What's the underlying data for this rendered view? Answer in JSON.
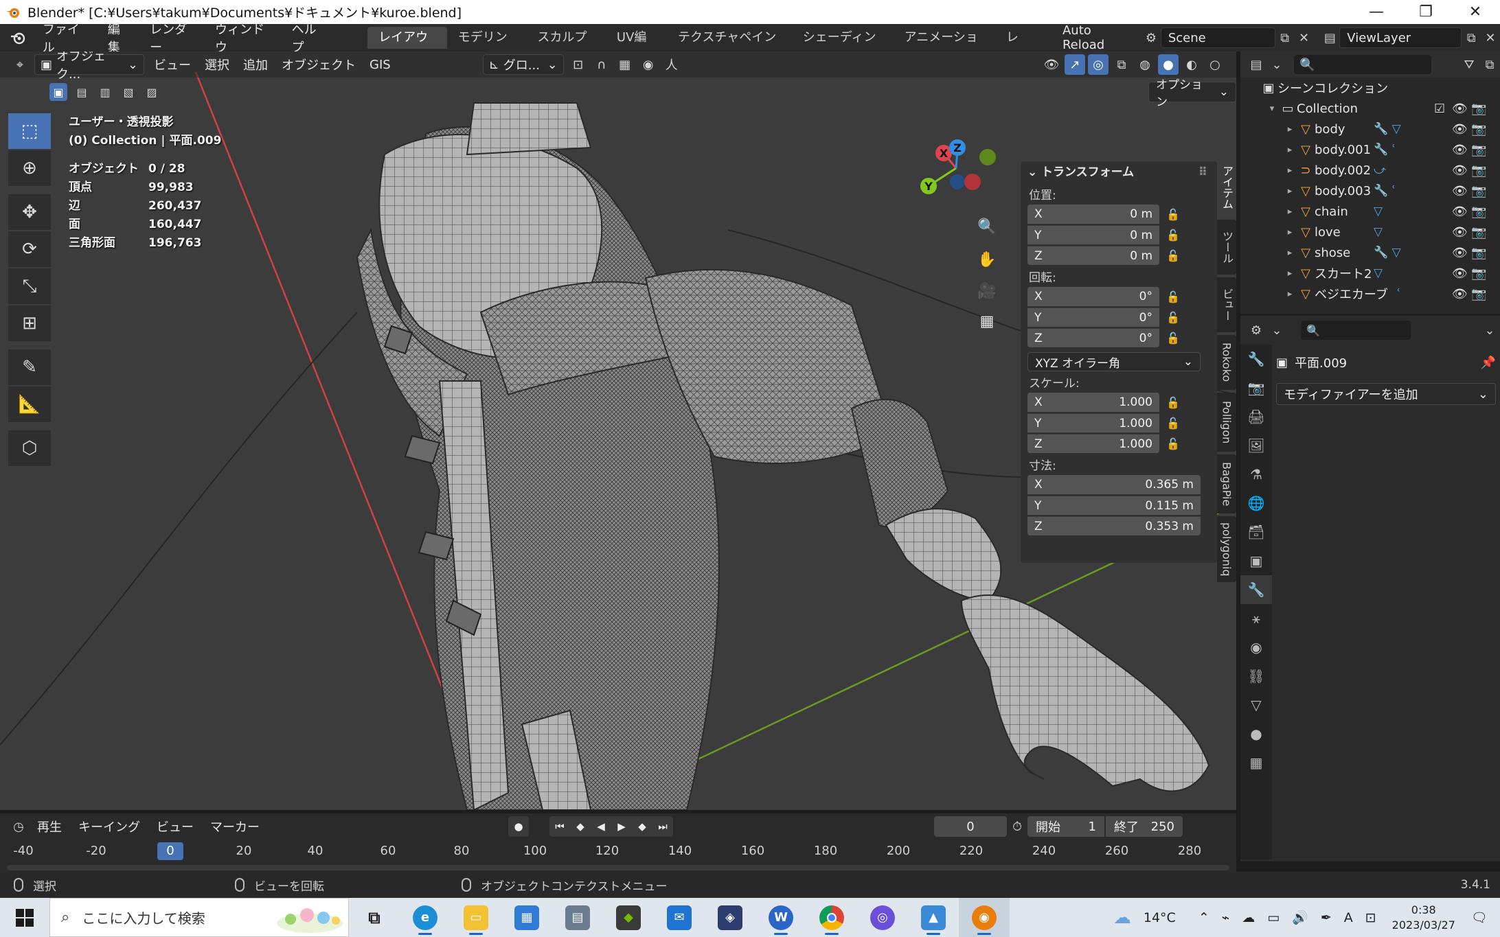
{
  "window": {
    "title": "Blender* [C:¥Users¥takum¥Documents¥ドキュメント¥kuroe.blend]",
    "minimize": "—",
    "restore": "❐",
    "close": "✕"
  },
  "topbar": {
    "menus": [
      "ファイル",
      "編集",
      "レンダー",
      "ウィンドウ",
      "ヘルプ"
    ],
    "workspaces": [
      "レイアウト",
      "モデリング",
      "スカルプト",
      "UV編集",
      "テクスチャペイント",
      "シェーディング",
      "アニメーション",
      "レン"
    ],
    "active_workspace": "レイアウト",
    "auto_reload": "Auto Reload",
    "scene": "Scene",
    "view_layer": "ViewLayer"
  },
  "viewport": {
    "mode": "オブジェク...",
    "menus": [
      "ビュー",
      "選択",
      "追加",
      "オブジェクト",
      "GIS"
    ],
    "transform_orientation": "グロ...",
    "options": "オプション",
    "view_name": "ユーザー・透視投影",
    "collection_info": "(0) Collection | 平面.009",
    "stats": [
      {
        "label": "オブジェクト",
        "value": "0 / 28"
      },
      {
        "label": "頂点",
        "value": "99,983"
      },
      {
        "label": "辺",
        "value": "260,437"
      },
      {
        "label": "面",
        "value": "160,447"
      },
      {
        "label": "三角形面",
        "value": "196,763"
      }
    ],
    "gizmo_axes": {
      "x": "X",
      "y": "Y",
      "z": "Z"
    },
    "colors": {
      "x_axis": "#e0444e",
      "y_axis": "#82c91e",
      "z_axis": "#2f8fe8",
      "accent": "#4772b3"
    }
  },
  "npanel": {
    "title": "トランスフォーム",
    "location_label": "位置:",
    "location": [
      {
        "axis": "X",
        "value": "0 m"
      },
      {
        "axis": "Y",
        "value": "0 m"
      },
      {
        "axis": "Z",
        "value": "0 m"
      }
    ],
    "rotation_label": "回転:",
    "rotation": [
      {
        "axis": "X",
        "value": "0°"
      },
      {
        "axis": "Y",
        "value": "0°"
      },
      {
        "axis": "Z",
        "value": "0°"
      }
    ],
    "rotation_mode": "XYZ オイラー角",
    "scale_label": "スケール:",
    "scale": [
      {
        "axis": "X",
        "value": "1.000"
      },
      {
        "axis": "Y",
        "value": "1.000"
      },
      {
        "axis": "Z",
        "value": "1.000"
      }
    ],
    "dimensions_label": "寸法:",
    "dimensions": [
      {
        "axis": "X",
        "value": "0.365 m"
      },
      {
        "axis": "Y",
        "value": "0.115 m"
      },
      {
        "axis": "Z",
        "value": "0.353 m"
      }
    ],
    "tabs": [
      "アイテム",
      "ツール",
      "ビュー",
      "Rokoko",
      "Polligon",
      "BagaPie",
      "polygoniq"
    ]
  },
  "outliner": {
    "scene_collection": "シーンコレクション",
    "collection": "Collection",
    "items": [
      {
        "name": "body",
        "mods": "🔧 ▽"
      },
      {
        "name": "body.001",
        "mods": "🔧 ʿ"
      },
      {
        "name": "body.002",
        "mods": "⤻"
      },
      {
        "name": "body.003",
        "mods": "🔧 ʿ"
      },
      {
        "name": "chain",
        "mods": "▽"
      },
      {
        "name": "love",
        "mods": "▽"
      },
      {
        "name": "shose",
        "mods": "🔧 ▽"
      },
      {
        "name": "スカート2",
        "mods": "▽"
      },
      {
        "name": "ベジエカーブ",
        "mods": "ʿ"
      }
    ]
  },
  "properties": {
    "object_name": "平面.009",
    "add_modifier": "モディファイアーを追加"
  },
  "timeline": {
    "menus": [
      "再生",
      "キーイング",
      "ビュー",
      "マーカー"
    ],
    "current_frame": "0",
    "start_label": "開始",
    "start": "1",
    "end_label": "終了",
    "end": "250",
    "ticks": [
      "-40",
      "-20",
      "0",
      "20",
      "40",
      "60",
      "80",
      "100",
      "120",
      "140",
      "160",
      "180",
      "200",
      "220",
      "240",
      "260",
      "280"
    ]
  },
  "statusbar": {
    "select": "選択",
    "rotate_view": "ビューを回転",
    "context_menu": "オブジェクトコンテクストメニュー",
    "version": "3.4.1"
  },
  "taskbar": {
    "search_placeholder": "ここに入力して検索",
    "weather": "14°C",
    "time": "0:38",
    "date": "2023/03/27",
    "ime": "A"
  }
}
